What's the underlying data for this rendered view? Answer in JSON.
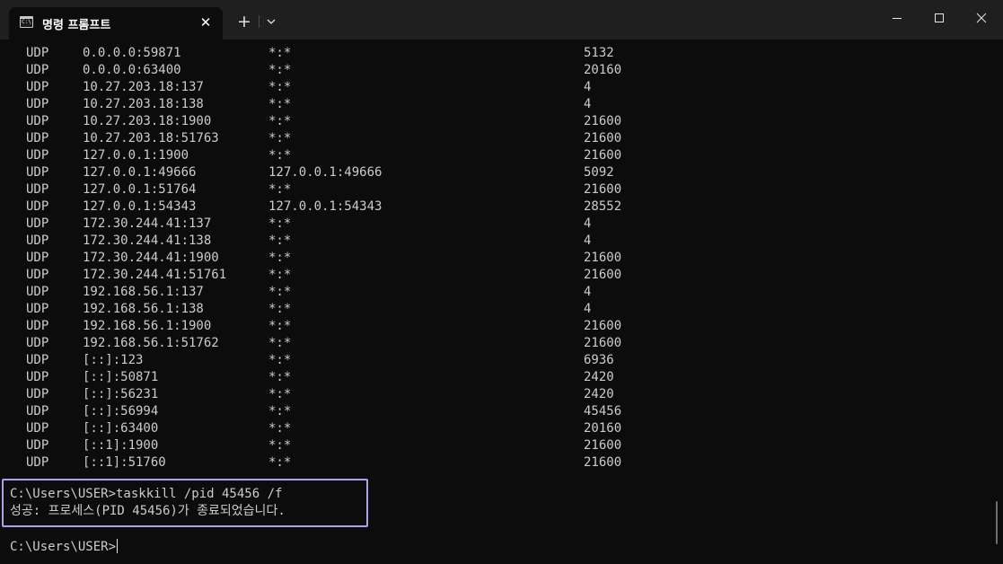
{
  "window": {
    "tab_title": "명령 프롬프트",
    "tab_icon_text": "C:\\",
    "new_tab_label": "+",
    "close_tab_label": "✕"
  },
  "netstat_rows": [
    {
      "proto": "UDP",
      "local": "0.0.0.0:59871",
      "foreign": "*:*",
      "pid": "5132"
    },
    {
      "proto": "UDP",
      "local": "0.0.0.0:63400",
      "foreign": "*:*",
      "pid": "20160"
    },
    {
      "proto": "UDP",
      "local": "10.27.203.18:137",
      "foreign": "*:*",
      "pid": "4"
    },
    {
      "proto": "UDP",
      "local": "10.27.203.18:138",
      "foreign": "*:*",
      "pid": "4"
    },
    {
      "proto": "UDP",
      "local": "10.27.203.18:1900",
      "foreign": "*:*",
      "pid": "21600"
    },
    {
      "proto": "UDP",
      "local": "10.27.203.18:51763",
      "foreign": "*:*",
      "pid": "21600"
    },
    {
      "proto": "UDP",
      "local": "127.0.0.1:1900",
      "foreign": "*:*",
      "pid": "21600"
    },
    {
      "proto": "UDP",
      "local": "127.0.0.1:49666",
      "foreign": "127.0.0.1:49666",
      "pid": "5092"
    },
    {
      "proto": "UDP",
      "local": "127.0.0.1:51764",
      "foreign": "*:*",
      "pid": "21600"
    },
    {
      "proto": "UDP",
      "local": "127.0.0.1:54343",
      "foreign": "127.0.0.1:54343",
      "pid": "28552"
    },
    {
      "proto": "UDP",
      "local": "172.30.244.41:137",
      "foreign": "*:*",
      "pid": "4"
    },
    {
      "proto": "UDP",
      "local": "172.30.244.41:138",
      "foreign": "*:*",
      "pid": "4"
    },
    {
      "proto": "UDP",
      "local": "172.30.244.41:1900",
      "foreign": "*:*",
      "pid": "21600"
    },
    {
      "proto": "UDP",
      "local": "172.30.244.41:51761",
      "foreign": "*:*",
      "pid": "21600"
    },
    {
      "proto": "UDP",
      "local": "192.168.56.1:137",
      "foreign": "*:*",
      "pid": "4"
    },
    {
      "proto": "UDP",
      "local": "192.168.56.1:138",
      "foreign": "*:*",
      "pid": "4"
    },
    {
      "proto": "UDP",
      "local": "192.168.56.1:1900",
      "foreign": "*:*",
      "pid": "21600"
    },
    {
      "proto": "UDP",
      "local": "192.168.56.1:51762",
      "foreign": "*:*",
      "pid": "21600"
    },
    {
      "proto": "UDP",
      "local": "[::]:123",
      "foreign": "*:*",
      "pid": "6936"
    },
    {
      "proto": "UDP",
      "local": "[::]:50871",
      "foreign": "*:*",
      "pid": "2420"
    },
    {
      "proto": "UDP",
      "local": "[::]:56231",
      "foreign": "*:*",
      "pid": "2420"
    },
    {
      "proto": "UDP",
      "local": "[::]:56994",
      "foreign": "*:*",
      "pid": "45456"
    },
    {
      "proto": "UDP",
      "local": "[::]:63400",
      "foreign": "*:*",
      "pid": "20160"
    },
    {
      "proto": "UDP",
      "local": "[::1]:1900",
      "foreign": "*:*",
      "pid": "21600"
    },
    {
      "proto": "UDP",
      "local": "[::1]:51760",
      "foreign": "*:*",
      "pid": "21600"
    }
  ],
  "command": "C:\\Users\\USER>taskkill /pid 45456 /f",
  "result": "성공: 프로세스(PID 45456)가 종료되었습니다.",
  "prompt": "C:\\Users\\USER>",
  "colors": {
    "background": "#0c0c0c",
    "titlebar": "#1f1f1f",
    "text": "#cccccc",
    "highlight_border": "#a8a3ea"
  }
}
